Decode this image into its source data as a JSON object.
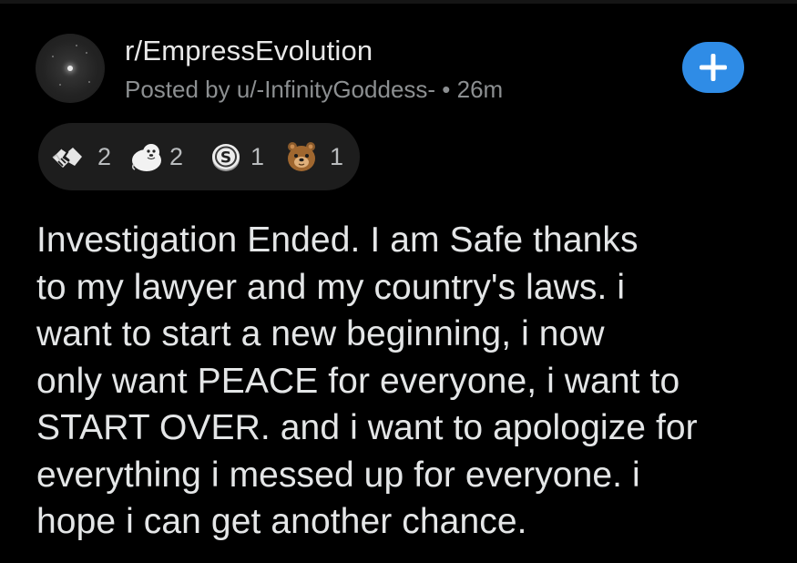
{
  "post": {
    "subreddit": "r/EmpressEvolution",
    "meta": "Posted by u/-InfinityGoddess- • 26m",
    "avatar_icon": "galaxy-avatar-icon",
    "join_icon": "plus-icon",
    "accent_color": "#2f8ce6",
    "awards": [
      {
        "icon": "handshake-award-icon",
        "count": "2"
      },
      {
        "icon": "wholesome-seal-award-icon",
        "count": "2"
      },
      {
        "icon": "silver-coin-award-icon",
        "count": "1"
      },
      {
        "icon": "bear-face-award-icon",
        "count": "1"
      }
    ],
    "body_lines": [
      "Investigation Ended. I am Safe thanks",
      "to my lawyer and my country's laws. i",
      "want to start a new beginning, i now",
      "only want PEACE for everyone, i want to",
      "START OVER. and i want to apologize for",
      "everything i messed up for everyone. i",
      "hope i can get another chance."
    ]
  }
}
